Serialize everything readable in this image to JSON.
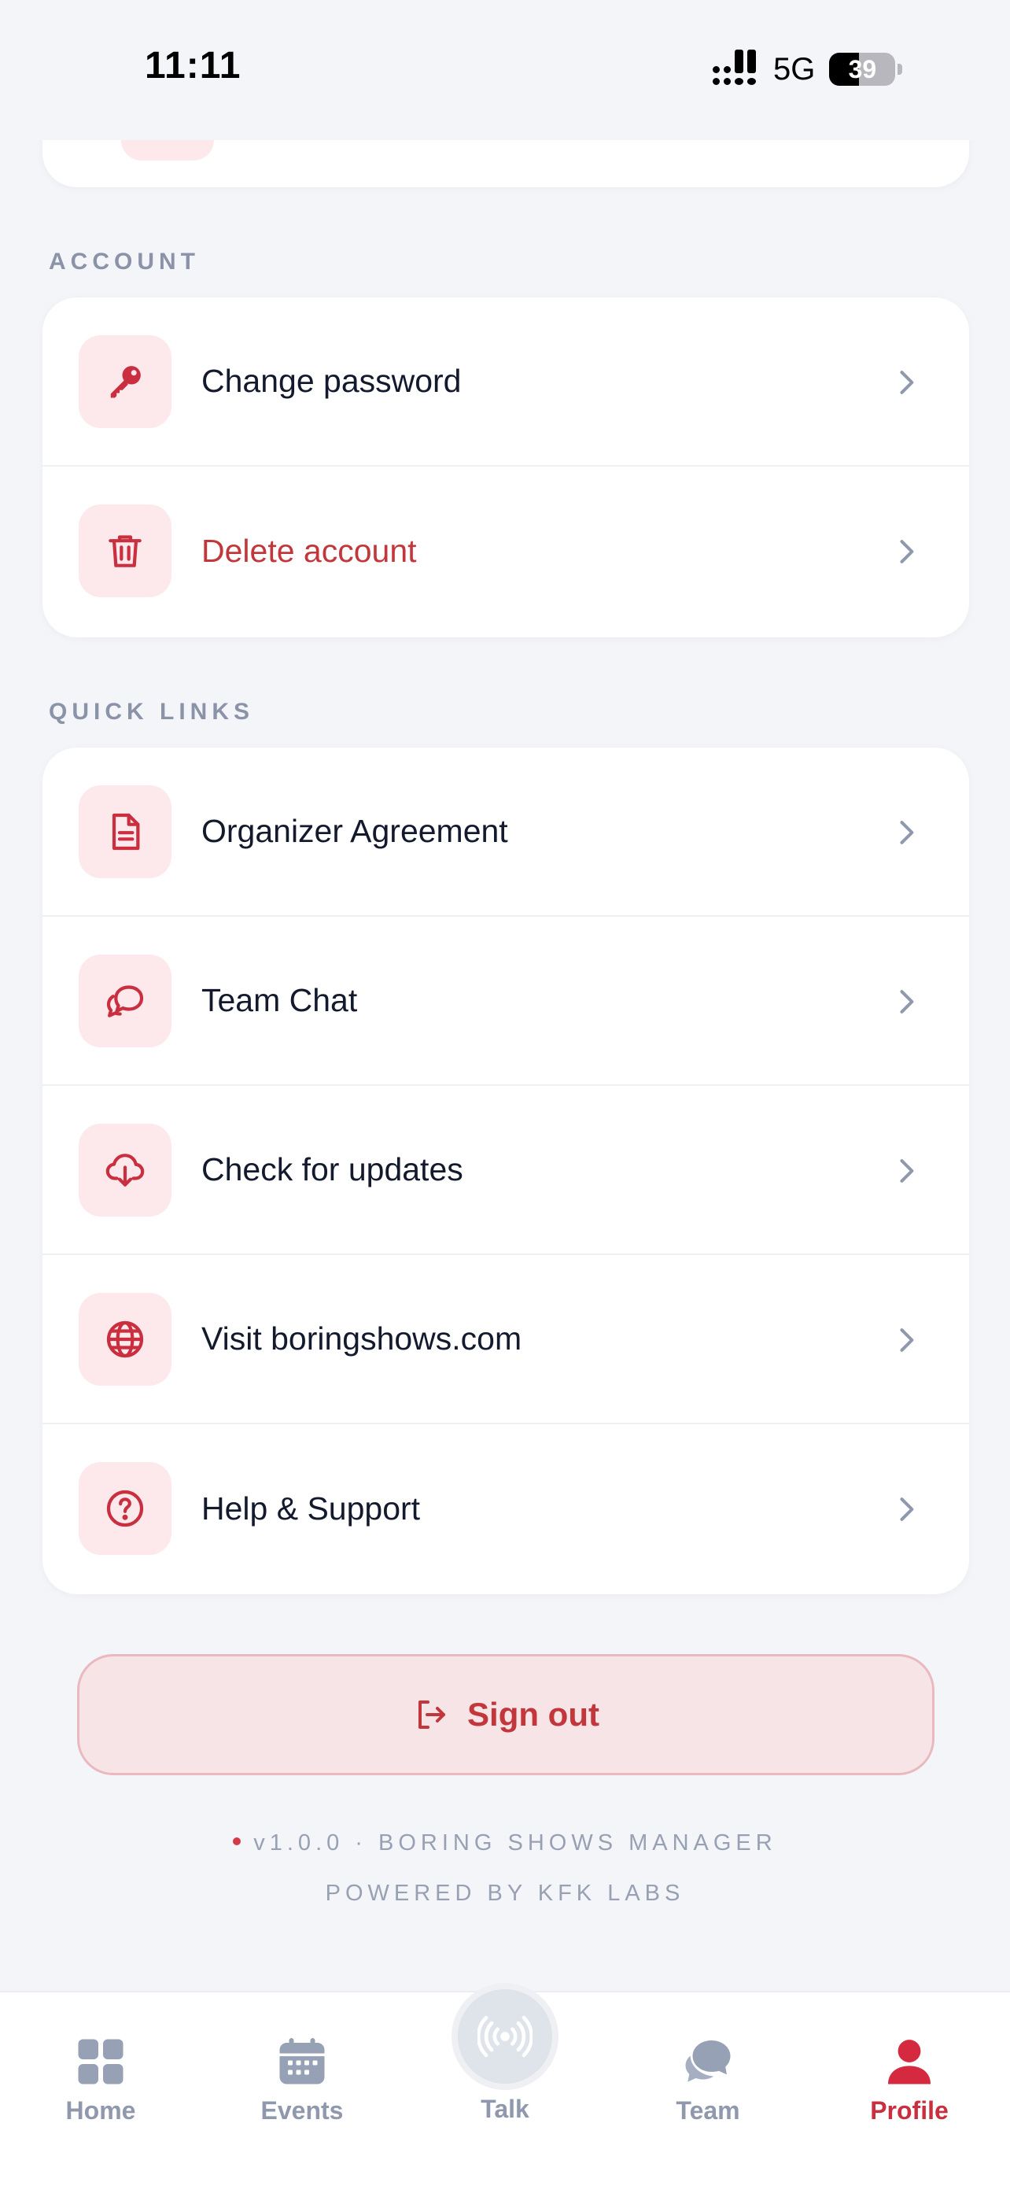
{
  "status_bar": {
    "time": "11:11",
    "network": "5G",
    "battery": "39"
  },
  "sections": {
    "account": {
      "title": "ACCOUNT",
      "items": [
        {
          "label": "Change password",
          "icon": "key-icon"
        },
        {
          "label": "Delete account",
          "icon": "trash-icon"
        }
      ]
    },
    "quick_links": {
      "title": "QUICK LINKS",
      "items": [
        {
          "label": "Organizer Agreement",
          "icon": "document-icon"
        },
        {
          "label": "Team Chat",
          "icon": "chat-icon"
        },
        {
          "label": "Check for updates",
          "icon": "cloud-download-icon"
        },
        {
          "label": "Visit boringshows.com",
          "icon": "globe-icon"
        },
        {
          "label": "Help & Support",
          "icon": "help-icon"
        }
      ]
    }
  },
  "sign_out": {
    "label": "Sign out"
  },
  "footer": {
    "version_line": "v1.0.0 · BORING SHOWS MANAGER",
    "powered_by": "POWERED BY KFK LABS"
  },
  "tab_bar": {
    "tabs": [
      {
        "label": "Home"
      },
      {
        "label": "Events"
      },
      {
        "label": "Talk"
      },
      {
        "label": "Team"
      },
      {
        "label": "Profile"
      }
    ],
    "active": "Profile"
  },
  "colors": {
    "accent": "#c92f3f",
    "danger": "#c2373c",
    "icon_tile": "#fde9ec",
    "muted": "#8f98ad",
    "background": "#f4f5f9"
  }
}
